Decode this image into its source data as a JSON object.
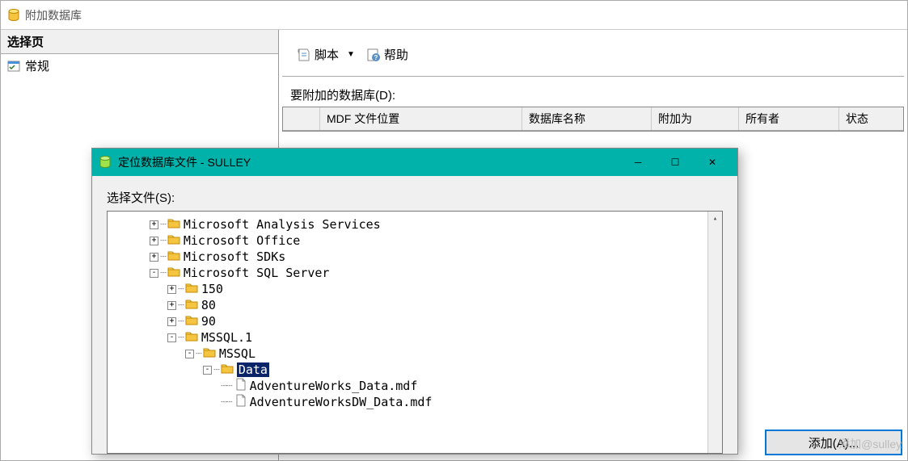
{
  "main_window": {
    "title": "附加数据库"
  },
  "sidebar": {
    "header": "选择页",
    "items": [
      {
        "label": "常规"
      }
    ]
  },
  "toolbar": {
    "script_label": "脚本",
    "help_label": "帮助"
  },
  "attach_section": {
    "label": "要附加的数据库(D):",
    "columns": {
      "blank": "",
      "location": "MDF 文件位置",
      "dbname": "数据库名称",
      "attach_as": "附加为",
      "owner": "所有者",
      "status": "状态"
    }
  },
  "add_button": "添加(A)...",
  "modal": {
    "title": "定位数据库文件 - SULLEY",
    "select_label": "选择文件(S):",
    "tree": [
      {
        "level": 0,
        "type": "folder",
        "exp": "+",
        "label": "Microsoft Analysis Services"
      },
      {
        "level": 0,
        "type": "folder",
        "exp": "+",
        "label": "Microsoft Office"
      },
      {
        "level": 0,
        "type": "folder",
        "exp": "+",
        "label": "Microsoft SDKs"
      },
      {
        "level": 0,
        "type": "folder",
        "exp": "-",
        "label": "Microsoft SQL Server"
      },
      {
        "level": 1,
        "type": "folder",
        "exp": "+",
        "label": "150"
      },
      {
        "level": 1,
        "type": "folder",
        "exp": "+",
        "label": "80"
      },
      {
        "level": 1,
        "type": "folder",
        "exp": "+",
        "label": "90"
      },
      {
        "level": 1,
        "type": "folder",
        "exp": "-",
        "label": "MSSQL.1"
      },
      {
        "level": 2,
        "type": "folder",
        "exp": "-",
        "label": "MSSQL"
      },
      {
        "level": 3,
        "type": "folder",
        "exp": "-",
        "label": "Data",
        "selected": true
      },
      {
        "level": 4,
        "type": "file",
        "exp": "",
        "label": "AdventureWorks_Data.mdf"
      },
      {
        "level": 4,
        "type": "file",
        "exp": "",
        "label": "AdventureWorksDW_Data.mdf"
      }
    ]
  },
  "watermark": "添加@sulley."
}
